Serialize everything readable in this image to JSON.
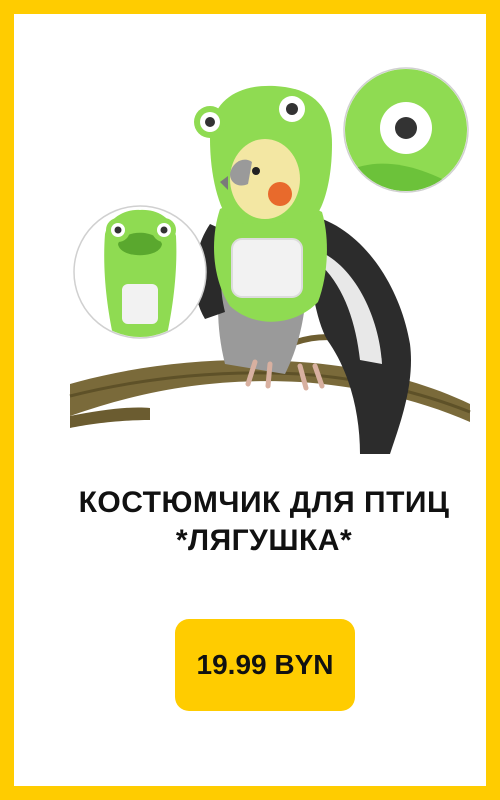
{
  "theme": {
    "border_color": "#ffcc00",
    "price_bg": "#ffcc00",
    "costume_green": "#8fdb52",
    "costume_green_dark": "#6cc23a"
  },
  "product": {
    "title_line1": "КОСТЮМЧИК ДЛЯ ПТИЦ",
    "title_line2": "*ЛЯГУШКА*",
    "price": "19.99 BYN",
    "image_icon": "frog-costume-parrot-photo"
  }
}
